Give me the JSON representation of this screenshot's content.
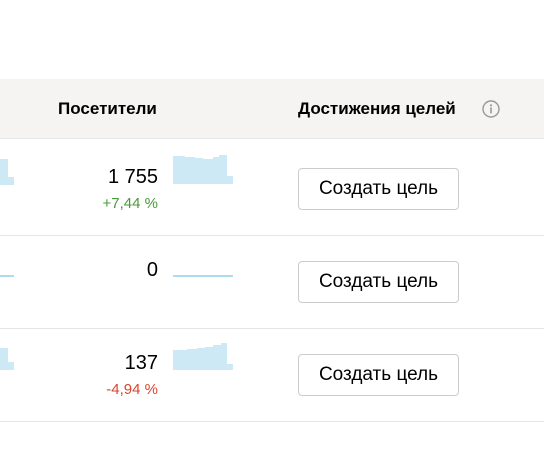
{
  "header": {
    "visitors_label": "Посетители",
    "goals_label": "Достижения целей",
    "info_icon": "info-circle-icon"
  },
  "colors": {
    "header_bg": "#f5f4f2",
    "sparkline_fill": "#cce9f5",
    "sparkline_stroke": "#8fd0ec",
    "delta_positive": "#4a9a3a",
    "delta_negative": "#d9452e"
  },
  "rows": [
    {
      "visitors": "1 755",
      "delta": "+7,44 %",
      "trend": "up",
      "button_label": "Создать цель"
    },
    {
      "visitors": "0",
      "delta": "",
      "trend": "flat",
      "button_label": "Создать цель"
    },
    {
      "visitors": "137",
      "delta": "-4,94 %",
      "trend": "down",
      "button_label": "Создать цель"
    }
  ]
}
